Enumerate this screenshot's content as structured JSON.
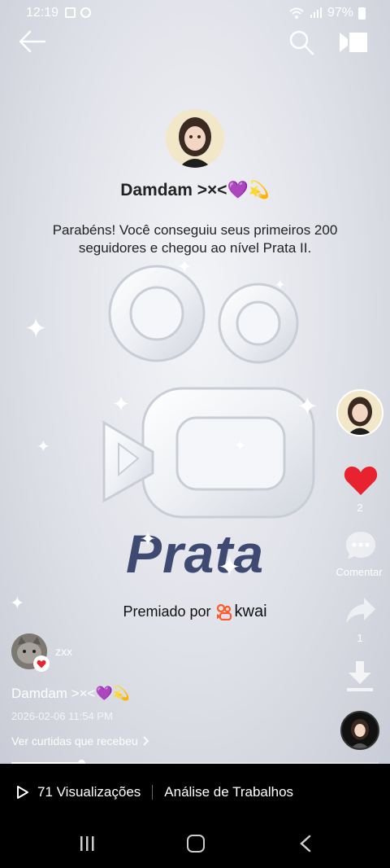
{
  "status_bar": {
    "time": "12:19",
    "battery": "97%"
  },
  "creator": {
    "name": "Damdam >×<💜💫",
    "message": "Parabéns! Você conseguiu seus primeiros 200 seguidores e chegou ao nível Prata II."
  },
  "badge": {
    "level_word": "Prata",
    "awarded_by": "Premiado por",
    "brand": "kwai"
  },
  "rail": {
    "like_count": "2",
    "comment_label": "Comentar",
    "share_count": "1"
  },
  "post": {
    "username": "zxx",
    "caption": "Damdam >×<💜💫",
    "date": "2026-02-06 11:54 PM",
    "likes_link": "Ver curtidas que recebeu",
    "progress": 0.19
  },
  "bottom_bar": {
    "views": "71 Visualizações",
    "analysis": "Análise de Trabalhos"
  },
  "colors": {
    "like_red": "#e8232f",
    "prata_text": "#3f4a73",
    "kwai_orange": "#ff5a2c"
  }
}
